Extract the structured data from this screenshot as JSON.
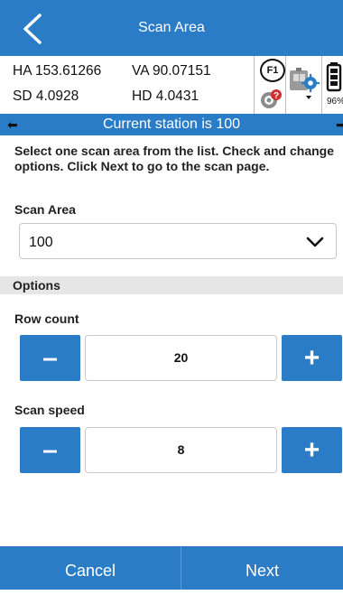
{
  "header": {
    "title": "Scan Area",
    "back_icon": "back-chevron-icon"
  },
  "status": {
    "ha": "HA 153.61266",
    "va": "VA 90.07151",
    "sd": "SD 4.0928",
    "hd": "HD 4.0431",
    "f1_label": "F1",
    "battery_percent": "96%"
  },
  "station_bar": {
    "text": "Current station is 100"
  },
  "instructions": "Select one scan area from the list. Check and change options. Click Next to go to the scan page.",
  "scan_area": {
    "label": "Scan Area",
    "value": "100"
  },
  "options": {
    "header": "Options",
    "row_count": {
      "label": "Row count",
      "value": "20",
      "minus": "–",
      "plus": "+"
    },
    "scan_speed": {
      "label": "Scan speed",
      "value": "8",
      "minus": "–",
      "plus": "+"
    }
  },
  "footer": {
    "cancel": "Cancel",
    "next": "Next"
  },
  "colors": {
    "accent": "#2b7cc6",
    "options_band": "#e6e6e6"
  }
}
